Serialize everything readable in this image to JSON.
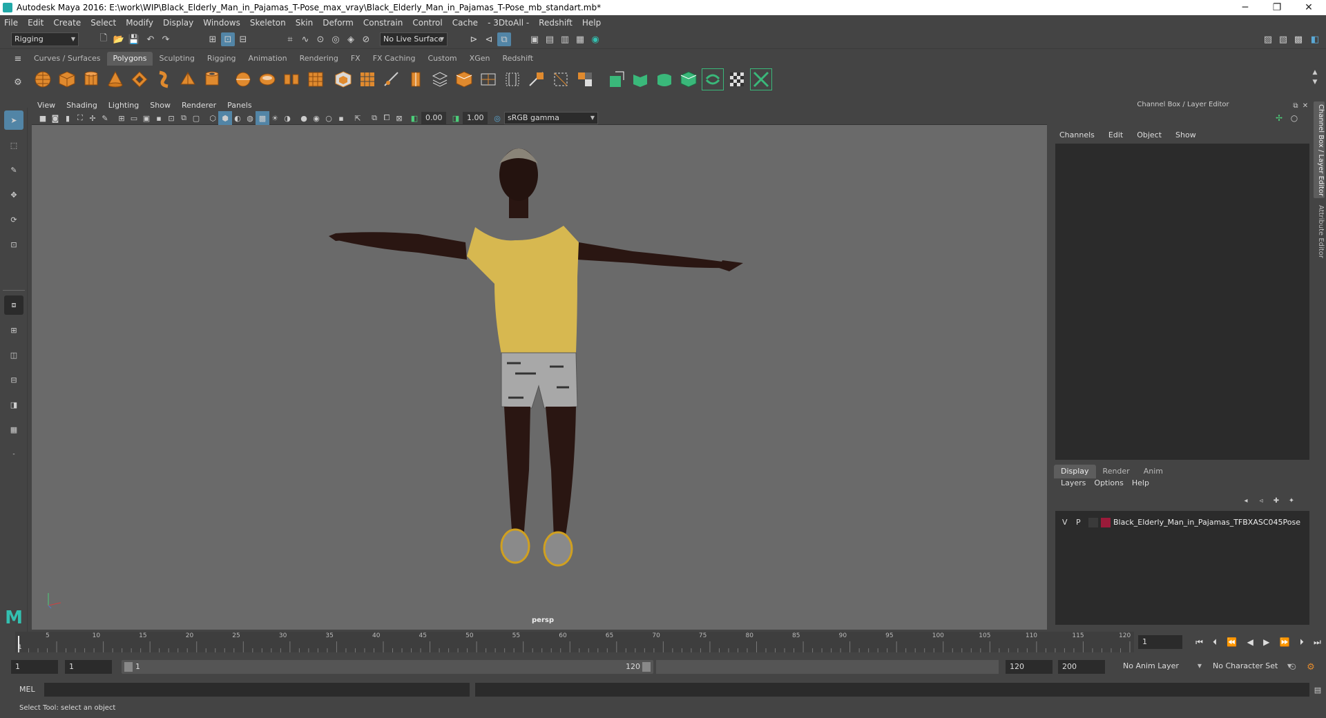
{
  "window": {
    "title": "Autodesk Maya 2016: E:\\work\\WIP\\Black_Elderly_Man_in_Pajamas_T-Pose_max_vray\\Black_Elderly_Man_in_Pajamas_T-Pose_mb_standart.mb*"
  },
  "menu": [
    "File",
    "Edit",
    "Create",
    "Select",
    "Modify",
    "Display",
    "Windows",
    "Skeleton",
    "Skin",
    "Deform",
    "Constrain",
    "Control",
    "Cache",
    "- 3DtoAll -",
    "Redshift",
    "Help"
  ],
  "status": {
    "mode": "Rigging",
    "live_surface": "No Live Surface"
  },
  "shelf": {
    "tabs": [
      "Curves / Surfaces",
      "Polygons",
      "Sculpting",
      "Rigging",
      "Animation",
      "Rendering",
      "FX",
      "FX Caching",
      "Custom",
      "XGen",
      "Redshift"
    ],
    "active": "Polygons"
  },
  "panel": {
    "menu": [
      "View",
      "Shading",
      "Lighting",
      "Show",
      "Renderer",
      "Panels"
    ],
    "exposure": "0.00",
    "gamma": "1.00",
    "colorspace": "sRGB gamma"
  },
  "viewport": {
    "camera": "persp"
  },
  "channel_box": {
    "header": "Channel Box / Layer Editor",
    "menu": [
      "Channels",
      "Edit",
      "Object",
      "Show"
    ]
  },
  "layer_editor": {
    "tabs": [
      "Display",
      "Render",
      "Anim"
    ],
    "active": "Display",
    "menu": [
      "Layers",
      "Options",
      "Help"
    ],
    "layers": [
      {
        "v": "V",
        "p": "P",
        "color": "#9b1b3a",
        "name": "Black_Elderly_Man_in_Pajamas_TFBXASC045Pose"
      }
    ]
  },
  "side_tabs": [
    "Channel Box / Layer Editor",
    "Attribute Editor"
  ],
  "timeline": {
    "ticks": [
      "5",
      "10",
      "15",
      "20",
      "25",
      "30",
      "35",
      "40",
      "45",
      "50",
      "55",
      "60",
      "65",
      "70",
      "75",
      "80",
      "85",
      "90",
      "95",
      "100",
      "105",
      "110",
      "115",
      "120"
    ],
    "start_label": "1",
    "current_frame": "1"
  },
  "range": {
    "start": "1",
    "anim_start": "1",
    "slider_start": "1",
    "slider_end": "120",
    "end": "120",
    "anim_end": "200",
    "anim_layer": "No Anim Layer",
    "char_set": "No Character Set"
  },
  "mel": {
    "label": "MEL"
  },
  "help": {
    "text": "Select Tool: select an object"
  }
}
